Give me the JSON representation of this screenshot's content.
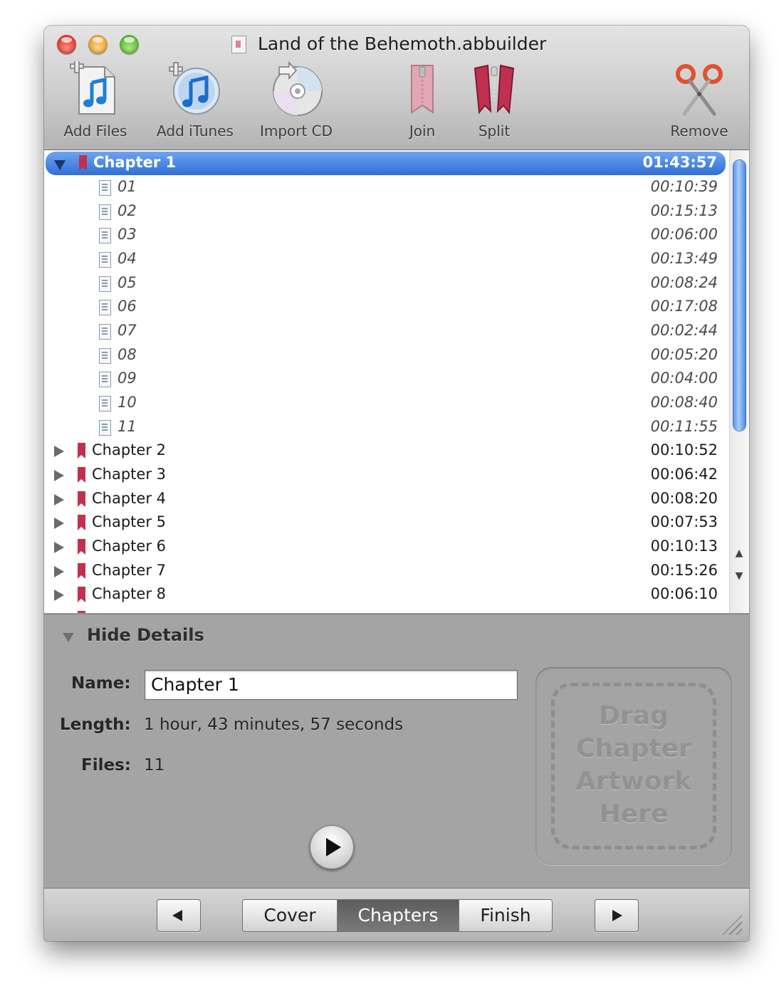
{
  "window": {
    "title": "Land of the Behemoth.abbuilder"
  },
  "toolbar": {
    "add_files": "Add Files",
    "add_itunes": "Add iTunes",
    "import_cd": "Import CD",
    "join": "Join",
    "split": "Split",
    "remove": "Remove"
  },
  "chapters": {
    "selected": {
      "name": "Chapter 1",
      "duration": "01:43:57"
    },
    "files": [
      {
        "name": "01",
        "duration": "00:10:39"
      },
      {
        "name": "02",
        "duration": "00:15:13"
      },
      {
        "name": "03",
        "duration": "00:06:00"
      },
      {
        "name": "04",
        "duration": "00:13:49"
      },
      {
        "name": "05",
        "duration": "00:08:24"
      },
      {
        "name": "06",
        "duration": "00:17:08"
      },
      {
        "name": "07",
        "duration": "00:02:44"
      },
      {
        "name": "08",
        "duration": "00:05:20"
      },
      {
        "name": "09",
        "duration": "00:04:00"
      },
      {
        "name": "10",
        "duration": "00:08:40"
      },
      {
        "name": "11",
        "duration": "00:11:55"
      }
    ],
    "collapsed": [
      {
        "name": "Chapter 2",
        "duration": "00:10:52"
      },
      {
        "name": "Chapter 3",
        "duration": "00:06:42"
      },
      {
        "name": "Chapter 4",
        "duration": "00:08:20"
      },
      {
        "name": "Chapter 5",
        "duration": "00:07:53"
      },
      {
        "name": "Chapter 6",
        "duration": "00:10:13"
      },
      {
        "name": "Chapter 7",
        "duration": "00:15:26"
      },
      {
        "name": "Chapter 8",
        "duration": "00:06:10"
      }
    ]
  },
  "details": {
    "toggle_label": "Hide Details",
    "name_label": "Name:",
    "name_value": "Chapter 1",
    "length_label": "Length:",
    "length_value": "1 hour, 43 minutes, 57 seconds",
    "files_label": "Files:",
    "files_value": "11",
    "artwork_line1": "Drag",
    "artwork_line2": "Chapter",
    "artwork_line3": "Artwork",
    "artwork_line4": "Here"
  },
  "footer": {
    "tabs": [
      "Cover",
      "Chapters",
      "Finish"
    ],
    "active_tab": "Chapters"
  },
  "colors": {
    "selection": "#3a7ae0",
    "bookmark": "#c2304e",
    "details_bg": "#a4a4a4"
  }
}
